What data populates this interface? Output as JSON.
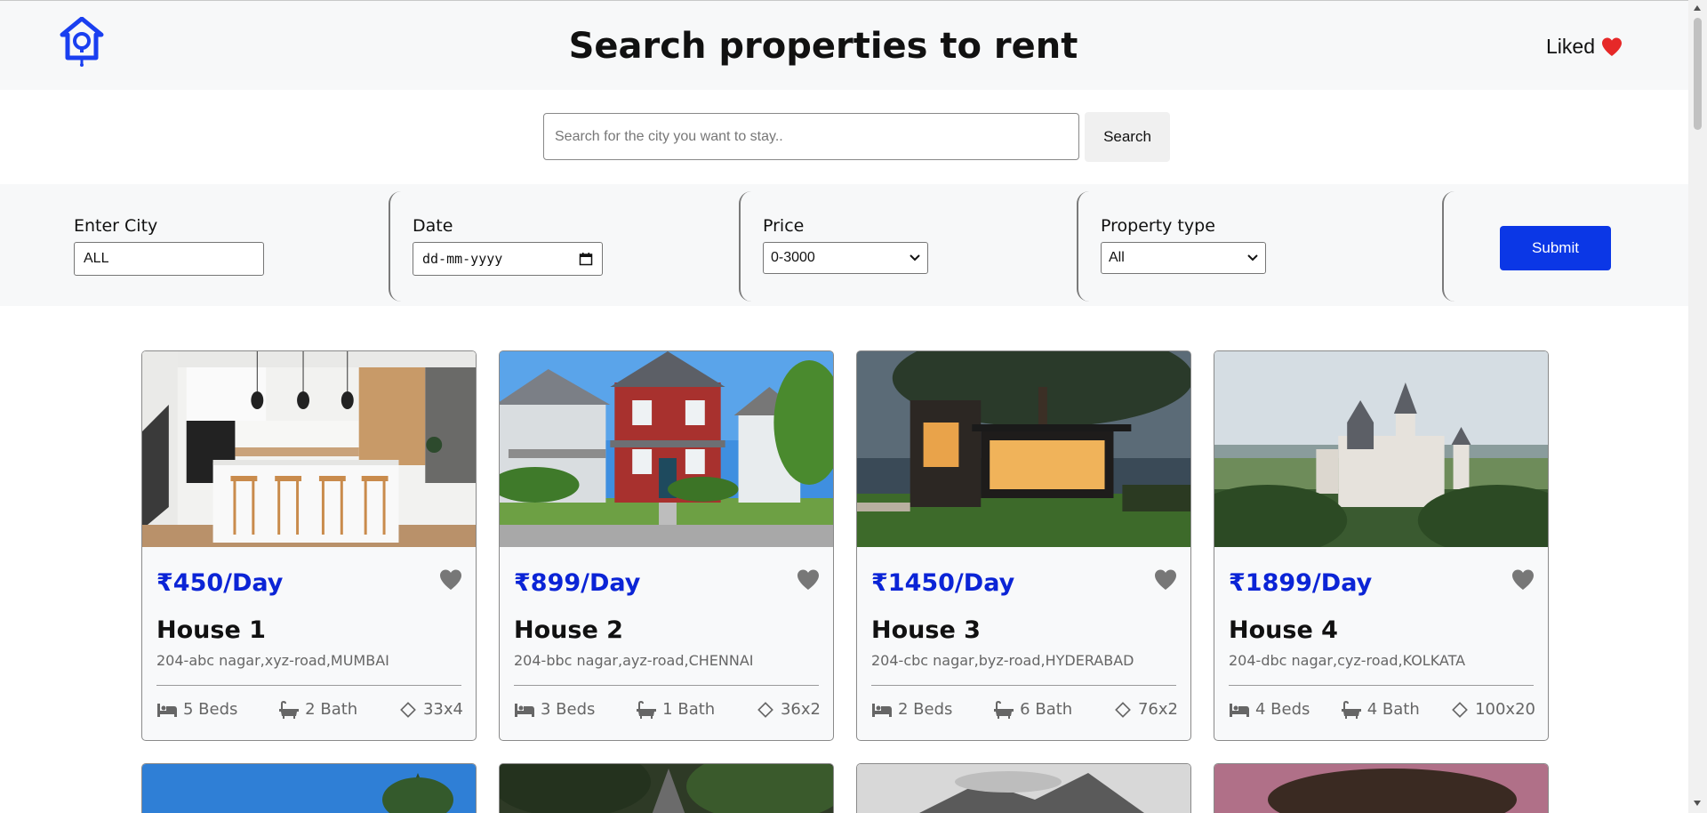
{
  "header": {
    "title": "Search properties to rent",
    "liked_label": "Liked",
    "logo_icon": "house-logo-icon",
    "heart_icon": "heart-icon",
    "accent": "#0b37e6"
  },
  "search": {
    "placeholder": "Search for the city you want to stay..",
    "value": "",
    "button_label": "Search"
  },
  "filters": {
    "city": {
      "label": "Enter City",
      "value": "ALL"
    },
    "date": {
      "label": "Date",
      "value": "dd-mm-yyyy"
    },
    "price": {
      "label": "Price",
      "value": "0-3000"
    },
    "property_type": {
      "label": "Property type",
      "value": "All"
    },
    "submit_label": "Submit"
  },
  "cards": [
    {
      "price": "₹450/Day",
      "name": "House 1",
      "address": "204-abc nagar,xyz-road,MUMBAI",
      "beds": "5 Beds",
      "bath": "2 Bath",
      "area": "33x4"
    },
    {
      "price": "₹899/Day",
      "name": "House 2",
      "address": "204-bbc nagar,ayz-road,CHENNAI",
      "beds": "3 Beds",
      "bath": "1 Bath",
      "area": "36x2"
    },
    {
      "price": "₹1450/Day",
      "name": "House 3",
      "address": "204-cbc nagar,byz-road,HYDERABAD",
      "beds": "2 Beds",
      "bath": "6 Bath",
      "area": "76x2"
    },
    {
      "price": "₹1899/Day",
      "name": "House 4",
      "address": "204-dbc nagar,cyz-road,KOLKATA",
      "beds": "4 Beds",
      "bath": "4 Bath",
      "area": "100x20"
    }
  ],
  "colors": {
    "price_text": "#0b24d6",
    "submit_bg": "#0b37e6",
    "heart_liked": "#e62828",
    "heart_card": "#777777"
  }
}
